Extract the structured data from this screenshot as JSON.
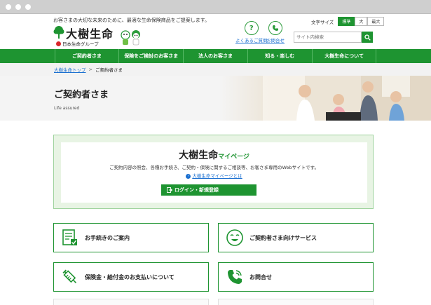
{
  "header": {
    "tagline": "お客さまの大切な未来のために、最適な生命保険商品をご提案します。",
    "logo_main": "大樹生命",
    "logo_sub": "日本生命グループ",
    "faq_label": "よくあるご質問",
    "contact_label": "お問合せ",
    "font_size_label": "文字サイズ",
    "font_sizes": [
      "標準",
      "大",
      "最大"
    ],
    "search_placeholder": "サイト内検索"
  },
  "nav": {
    "items": [
      "ご契約者さま",
      "保険をご検討のお客さま",
      "法人のお客さま",
      "知る・楽しむ",
      "大樹生命について"
    ]
  },
  "breadcrumb": {
    "home": "大樹生命トップ",
    "separator": ">",
    "current": "ご契約者さま"
  },
  "hero": {
    "title": "ご契約者さま",
    "subtitle": "Life assured"
  },
  "mypage": {
    "title_main": "大樹生命",
    "title_accent": "マイページ",
    "description": "ご契約内容の照会、各種お手続き、ご契約・保険に関するご相談等、お客さま専用のWebサイトです。",
    "about_link": "大樹生命マイページとは",
    "login_button": "ログイン・新規登録"
  },
  "cards": [
    {
      "label": "お手続きのご案内",
      "icon": "document-check-icon"
    },
    {
      "label": "ご契約者さま向けサービス",
      "icon": "smiley-icon"
    },
    {
      "label": "保険金・給付金のお支払いについて",
      "icon": "syringe-icon"
    },
    {
      "label": "お問合せ",
      "icon": "phone-icon"
    }
  ],
  "colors": {
    "brand_green": "#1e9431",
    "link_blue": "#1a6fd0",
    "mypage_bg": "#e8f4e4"
  }
}
